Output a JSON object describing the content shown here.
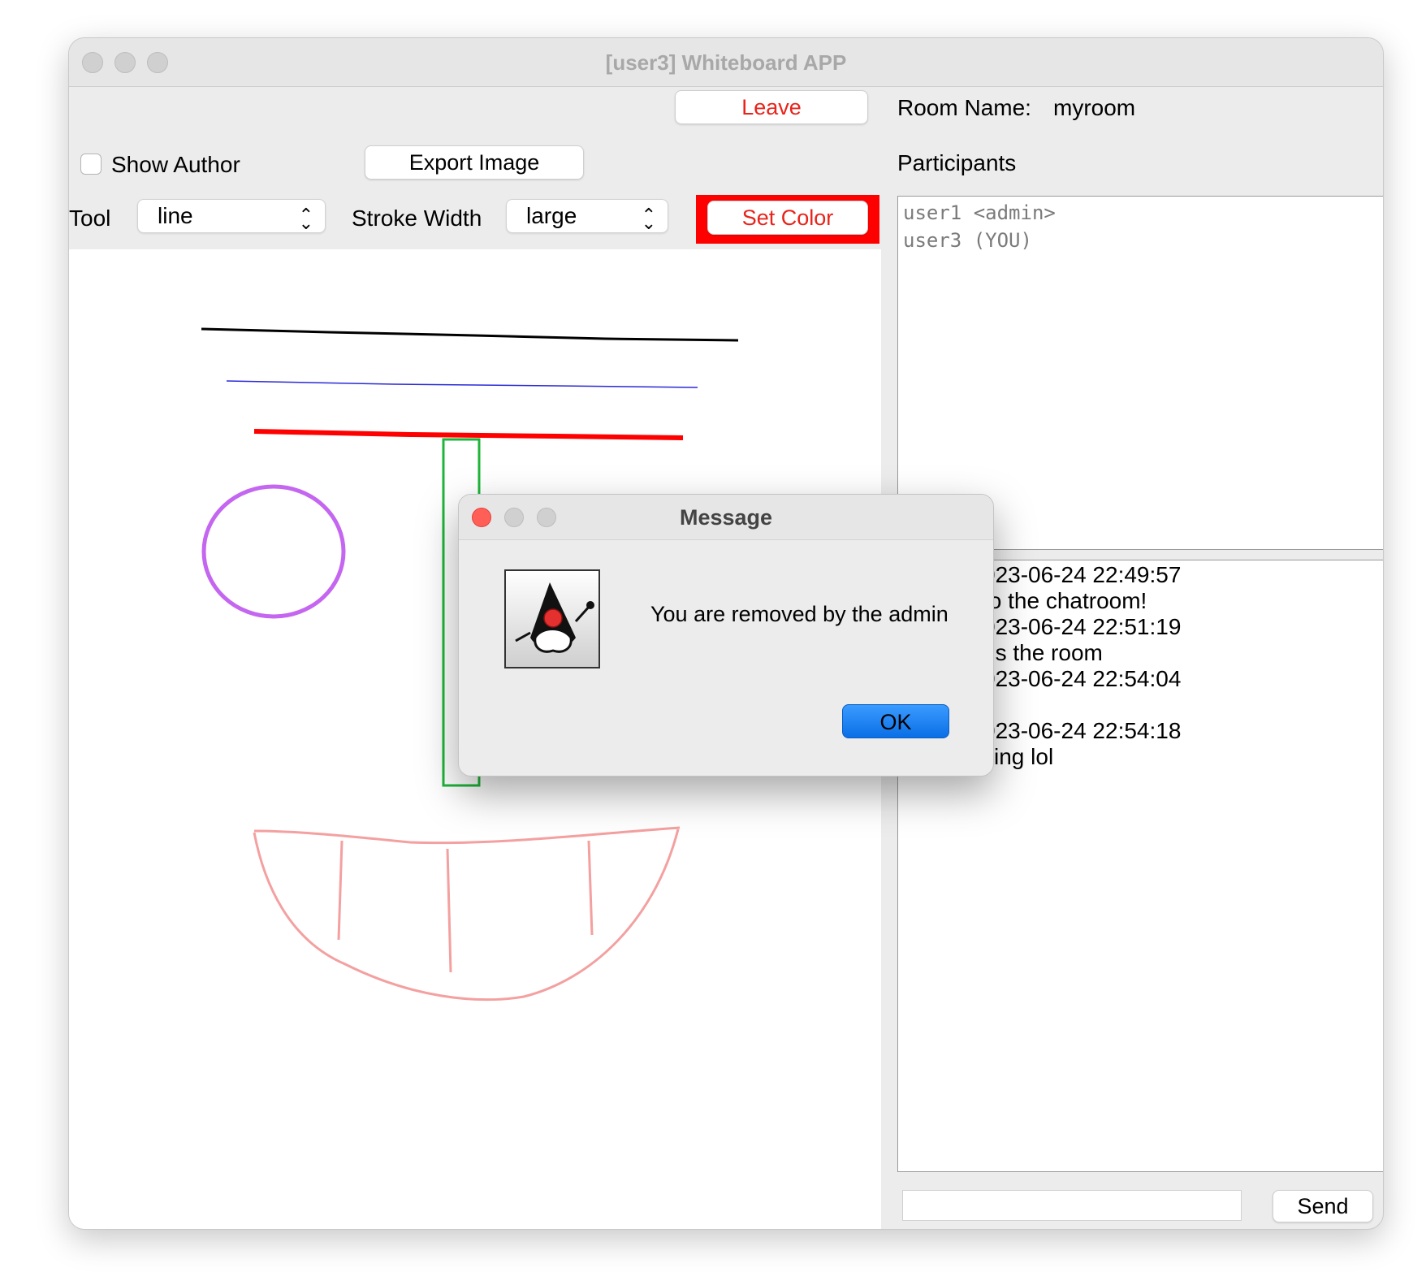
{
  "window": {
    "title": "[user3] Whiteboard APP"
  },
  "toolbar": {
    "leave_label": "Leave",
    "export_label": "Export Image",
    "show_author_label": "Show Author",
    "tool_label": "Tool",
    "tool_value": "line",
    "stroke_label": "Stroke Width",
    "stroke_value": "large",
    "set_color_label": "Set Color",
    "current_color": "#ff0000"
  },
  "room": {
    "name_label": "Room Name:",
    "name_value": "myroom",
    "participants_label": "Participants",
    "participants": [
      "user1 <admin>",
      "user3 (YOU)"
    ]
  },
  "chat": {
    "lines": [
      "023-06-24 22:49:57",
      " to the chatroom!",
      "023-06-24 22:51:19",
      "ns the room",
      "023-06-24 22:54:04",
      "",
      "023-06-24 22:54:18",
      "ving lol"
    ],
    "input_value": "",
    "send_label": "Send"
  },
  "whiteboard": {
    "stroke_colors": [
      "#000000",
      "#2a2ad8",
      "#ff0000",
      "#1fb53a",
      "#c466f0",
      "#f4a0a0"
    ]
  },
  "dialog": {
    "title": "Message",
    "message": "You are removed by the admin",
    "ok_label": "OK",
    "icon": "java-duke-icon"
  }
}
